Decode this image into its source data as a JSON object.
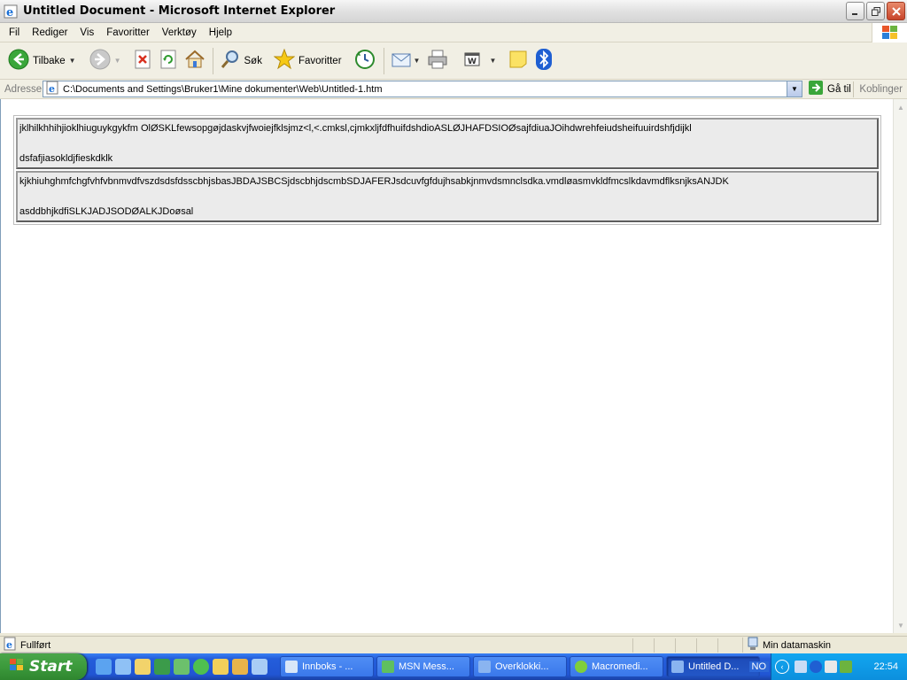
{
  "window": {
    "title": "Untitled Document - Microsoft Internet Explorer"
  },
  "menu": {
    "items": [
      "Fil",
      "Rediger",
      "Vis",
      "Favoritter",
      "Verktøy",
      "Hjelp"
    ]
  },
  "toolbar": {
    "back_label": "Tilbake",
    "search_label": "Søk",
    "favorites_label": "Favoritter"
  },
  "address": {
    "label": "Adresse",
    "url": "C:\\Documents and Settings\\Bruker1\\Mine dokumenter\\Web\\Untitled-1.htm",
    "go_label": "Gå til",
    "links_label": "Koblinger"
  },
  "content": {
    "rows": [
      {
        "line1": "jklhilkhhihjioklhiuguykgykfm OlØSKLfewsopgøjdaskvjfwoiejfklsjmz<l,<.cmksl,cjmkxljfdfhuifdshdioASLØJHAFDSIOØsajfdiuaJOihdwrehfeiudsheifuuirdshfjdijkl",
        "line2": "dsfafjiasokldjfieskdklk"
      },
      {
        "line1": "kjkhiuhghmfchgfvhfvbnmvdfvszdsdsfdsscbhjsbasJBDAJSBCSjdscbhjdscmbSDJAFERJsdcuvfgfdujhsabkjnmvdsmnclsdka.vmdløasmvkldfmcslkdavmdflksnjksANJDK",
        "line2": "asddbhjkdfiSLKJADJSODØALKJDoøsal"
      }
    ]
  },
  "status": {
    "text": "Fullført",
    "zone": "Min datamaskin"
  },
  "taskbar": {
    "start_label": "Start",
    "tasks": [
      {
        "label": "Innboks - ...",
        "color": "#d8e6f8"
      },
      {
        "label": "MSN Mess...",
        "color": "#5fbf5f"
      },
      {
        "label": "Overklokki...",
        "color": "#8ab4f0"
      },
      {
        "label": "Macromedi...",
        "color": "#7fce3c"
      },
      {
        "label": "Untitled D...",
        "color": "#8ab4f0"
      }
    ],
    "lang": "NO",
    "clock": "22:54"
  }
}
